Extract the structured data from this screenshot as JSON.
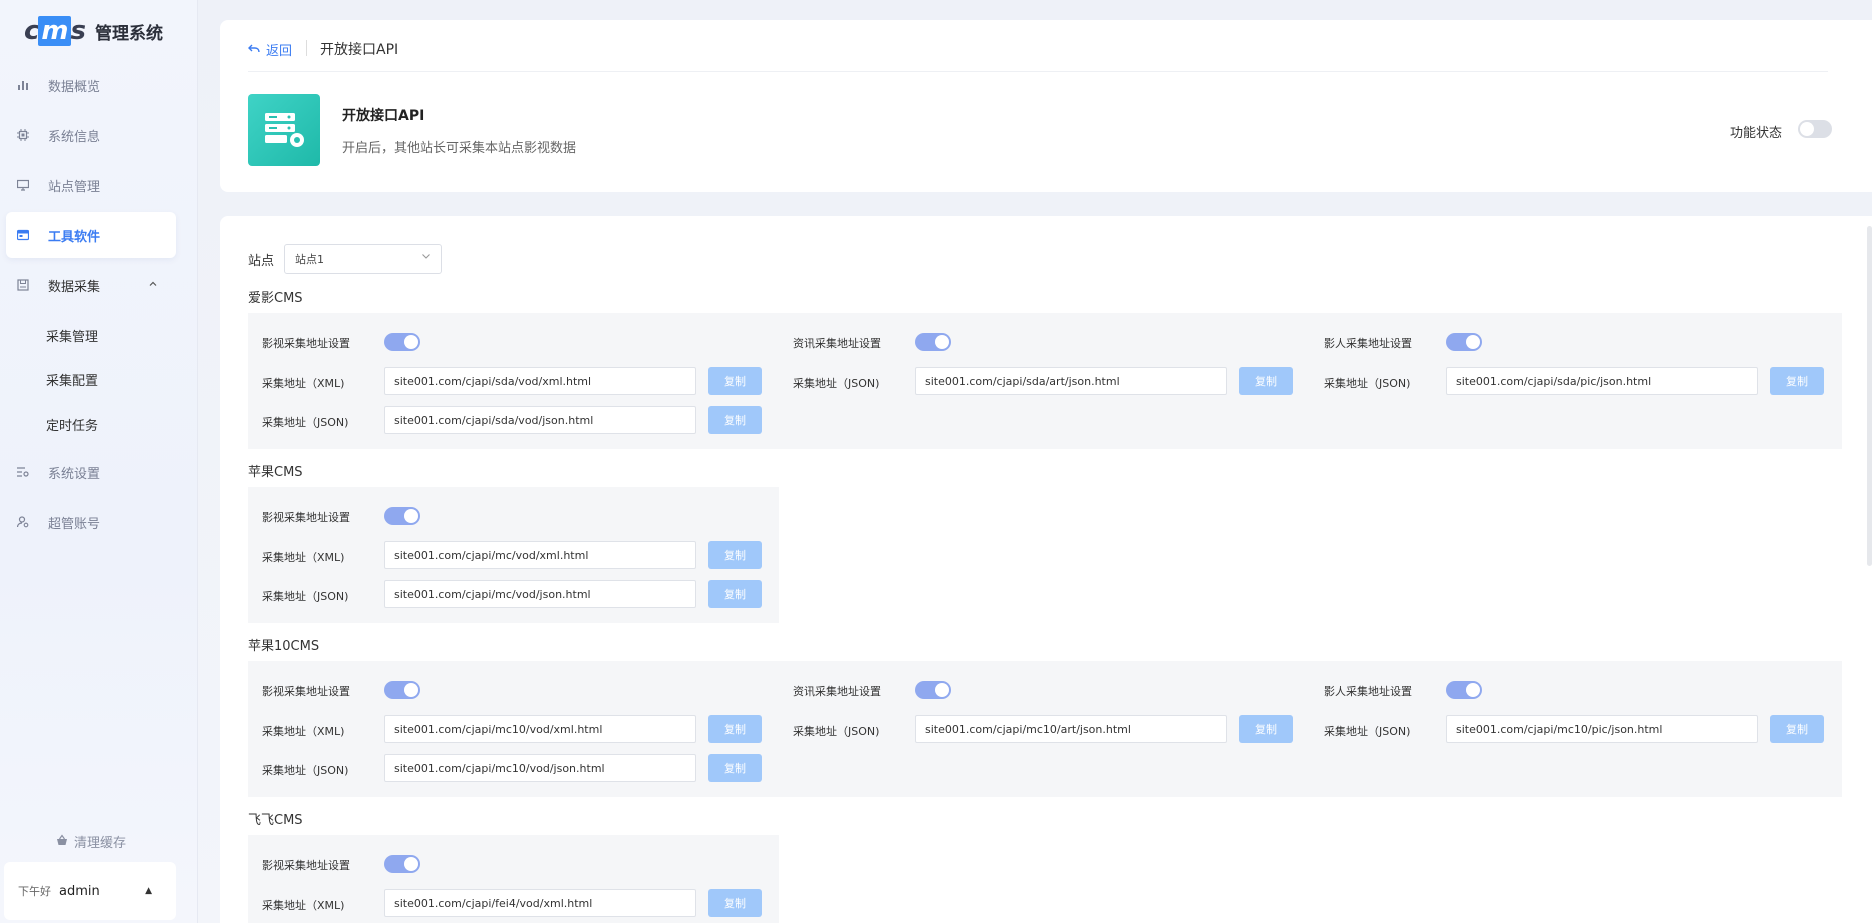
{
  "sidebar": {
    "logo_mark": "cms",
    "logo_text": "管理系统",
    "items": [
      {
        "label": "数据概览",
        "icon": "bar-chart-icon"
      },
      {
        "label": "系统信息",
        "icon": "chip-icon"
      },
      {
        "label": "站点管理",
        "icon": "monitor-icon"
      },
      {
        "label": "工具软件",
        "icon": "toolbox-icon"
      },
      {
        "label": "数据采集",
        "icon": "save-icon"
      },
      {
        "label": "系统设置",
        "icon": "settings-list-icon"
      },
      {
        "label": "超管账号",
        "icon": "user-gear-icon"
      }
    ],
    "sub_items": [
      "采集管理",
      "采集配置",
      "定时任务"
    ],
    "clear_cache": "清理缓存",
    "greeting": "下午好",
    "username": "admin"
  },
  "header": {
    "back": "返回",
    "breadcrumb": "开放接口API",
    "title": "开放接口API",
    "description": "开启后，其他站长可采集本站点影视数据",
    "status_label": "功能状态",
    "status_on": false
  },
  "main": {
    "site_label": "站点",
    "site_value": "站点1",
    "copy_label": "复制",
    "sections": [
      {
        "title": "爱影CMS",
        "groups": [
          {
            "toggle_label": "影视采集地址设置",
            "rows": [
              {
                "label": "采集地址（XML)",
                "url": "site001.com/cjapi/sda/vod/xml.html"
              },
              {
                "label": "采集地址（JSON)",
                "url": "site001.com/cjapi/sda/vod/json.html"
              }
            ]
          },
          {
            "toggle_label": "资讯采集地址设置",
            "rows": [
              {
                "label": "采集地址（JSON)",
                "url": "site001.com/cjapi/sda/art/json.html"
              }
            ]
          },
          {
            "toggle_label": "影人采集地址设置",
            "rows": [
              {
                "label": "采集地址（JSON)",
                "url": "site001.com/cjapi/sda/pic/json.html"
              }
            ]
          }
        ]
      },
      {
        "title": "苹果CMS",
        "groups": [
          {
            "toggle_label": "影视采集地址设置",
            "rows": [
              {
                "label": "采集地址（XML)",
                "url": "site001.com/cjapi/mc/vod/xml.html"
              },
              {
                "label": "采集地址（JSON)",
                "url": "site001.com/cjapi/mc/vod/json.html"
              }
            ]
          }
        ]
      },
      {
        "title": "苹果10CMS",
        "groups": [
          {
            "toggle_label": "影视采集地址设置",
            "rows": [
              {
                "label": "采集地址（XML)",
                "url": "site001.com/cjapi/mc10/vod/xml.html"
              },
              {
                "label": "采集地址（JSON)",
                "url": "site001.com/cjapi/mc10/vod/json.html"
              }
            ]
          },
          {
            "toggle_label": "资讯采集地址设置",
            "rows": [
              {
                "label": "采集地址（JSON)",
                "url": "site001.com/cjapi/mc10/art/json.html"
              }
            ]
          },
          {
            "toggle_label": "影人采集地址设置",
            "rows": [
              {
                "label": "采集地址（JSON)",
                "url": "site001.com/cjapi/mc10/pic/json.html"
              }
            ]
          }
        ]
      },
      {
        "title": "飞飞CMS",
        "groups": [
          {
            "toggle_label": "影视采集地址设置",
            "rows": [
              {
                "label": "采集地址（XML)",
                "url": "site001.com/cjapi/fei4/vod/xml.html"
              }
            ]
          }
        ]
      }
    ]
  }
}
